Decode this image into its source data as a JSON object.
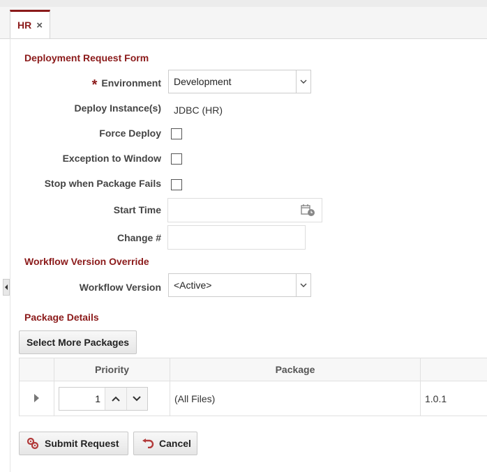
{
  "tabs": [
    {
      "label": "HR",
      "close": "×"
    }
  ],
  "form": {
    "title": "Deployment Request Form",
    "required_marker": "*",
    "environment": {
      "label": "Environment",
      "value": "Development"
    },
    "deploy_instances": {
      "label": "Deploy Instance(s)",
      "value": "JDBC (HR)"
    },
    "force_deploy": {
      "label": "Force Deploy",
      "checked": false
    },
    "exception_to_window": {
      "label": "Exception to Window",
      "checked": false
    },
    "stop_when_package_fails": {
      "label": "Stop when Package Fails",
      "checked": false
    },
    "start_time": {
      "label": "Start Time",
      "value": ""
    },
    "change_number": {
      "label": "Change #",
      "value": ""
    }
  },
  "workflow": {
    "title": "Workflow Version Override",
    "version": {
      "label": "Workflow Version",
      "value": "<Active>"
    }
  },
  "packages": {
    "title": "Package Details",
    "select_more_label": "Select More Packages",
    "columns": [
      "",
      "Priority",
      "Package",
      ""
    ],
    "rows": [
      {
        "priority": "1",
        "package": "(All Files)",
        "version": "1.0.1"
      }
    ]
  },
  "actions": {
    "submit_label": "Submit Request",
    "cancel_label": "Cancel"
  },
  "colors": {
    "accent": "#8b1a1a"
  },
  "icons": [
    "close-icon",
    "chevron-down-icon",
    "calendar-clock-icon",
    "expand-row-icon",
    "chevron-up-icon",
    "gears-icon",
    "undo-icon",
    "collapse-left-icon"
  ]
}
